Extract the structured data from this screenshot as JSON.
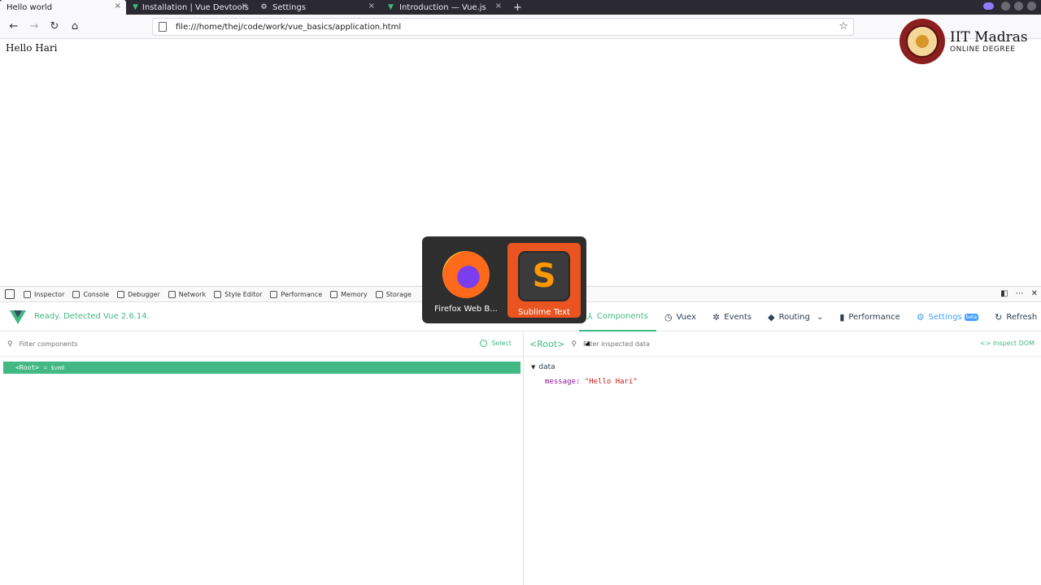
{
  "tabs": [
    {
      "label": "Hello world",
      "icon": "none",
      "active": true
    },
    {
      "label": "Installation | Vue Devtools",
      "icon": "vue-icon"
    },
    {
      "label": "Settings",
      "icon": "gear-icon"
    },
    {
      "label": "Introduction — Vue.js",
      "icon": "vue-icon"
    }
  ],
  "close_glyph": "×",
  "new_tab_glyph": "+",
  "nav": {
    "back_icon": "back-arrow-icon",
    "forward_icon": "forward-arrow-icon",
    "reload_icon": "reload-icon",
    "home_icon": "home-icon",
    "url": "file:///home/thej/code/work/vue_basics/application.html"
  },
  "page": {
    "text": "Hello Hari"
  },
  "logo": {
    "title": "IIT Madras",
    "subtitle": "ONLINE DEGREE"
  },
  "devtools": {
    "tabs": [
      "Inspector",
      "Console",
      "Debugger",
      "Network",
      "Style Editor",
      "Performance",
      "Memory",
      "Storage"
    ]
  },
  "vue": {
    "status": "Ready. Detected Vue 2.6.14.",
    "nav": [
      {
        "label": "Components",
        "icon": "components-icon",
        "active": true
      },
      {
        "label": "Vuex",
        "icon": "history-icon"
      },
      {
        "label": "Events",
        "icon": "events-icon"
      },
      {
        "label": "Routing",
        "icon": "routing-icon"
      },
      {
        "label": "Performance",
        "icon": "chart-icon"
      },
      {
        "label": "Settings",
        "icon": "settings-icon",
        "badge": "beta"
      },
      {
        "label": "Refresh",
        "icon": "refresh-icon"
      }
    ],
    "filter_components_placeholder": "Filter components",
    "select_label": "Select",
    "root_tag": "<Root>",
    "root_vm": "= $vm0",
    "right": {
      "title": "<Root>",
      "filter_placeholder": "Filter inspected data",
      "inspect_dom": "<> Inspect DOM",
      "section": "data",
      "prop_key": "message:",
      "prop_value": "\"Hello Hari\""
    }
  },
  "switcher": {
    "apps": [
      {
        "label": "Firefox Web B...",
        "icon": "firefox-icon"
      },
      {
        "label": "Sublime Text",
        "icon": "sublime-text-icon",
        "selected": true
      }
    ],
    "sublime_glyph": "S"
  },
  "colors": {
    "vue_green": "#42b983",
    "ubuntu_orange": "#e95420",
    "tabbar_bg": "#2b2a33"
  }
}
